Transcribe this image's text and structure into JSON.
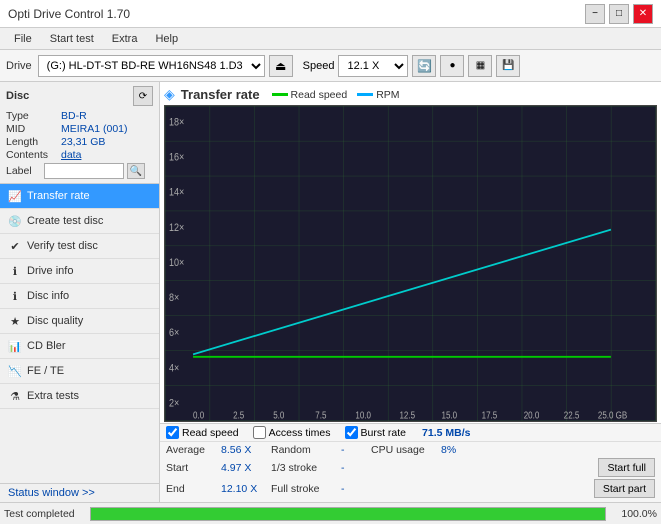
{
  "window": {
    "title": "Opti Drive Control 1.70",
    "min_label": "−",
    "max_label": "□",
    "close_label": "✕"
  },
  "menu": {
    "items": [
      "File",
      "Start test",
      "Extra",
      "Help"
    ]
  },
  "toolbar": {
    "drive_label": "Drive",
    "drive_value": "(G:)  HL-DT-ST BD-RE  WH16NS48 1.D3",
    "eject_icon": "⏏",
    "speed_label": "Speed",
    "speed_value": "12.1 X ▾",
    "toolbar_icons": [
      "🔄",
      "◉",
      "🖼",
      "💾"
    ]
  },
  "disc": {
    "title": "Disc",
    "type_label": "Type",
    "type_value": "BD-R",
    "mid_label": "MID",
    "mid_value": "MEIRA1 (001)",
    "length_label": "Length",
    "length_value": "23,31 GB",
    "contents_label": "Contents",
    "contents_value": "data",
    "label_label": "Label",
    "label_placeholder": ""
  },
  "nav": {
    "items": [
      {
        "id": "transfer-rate",
        "label": "Transfer rate",
        "active": true
      },
      {
        "id": "create-test-disc",
        "label": "Create test disc",
        "active": false
      },
      {
        "id": "verify-test-disc",
        "label": "Verify test disc",
        "active": false
      },
      {
        "id": "drive-info",
        "label": "Drive info",
        "active": false
      },
      {
        "id": "disc-info",
        "label": "Disc info",
        "active": false
      },
      {
        "id": "disc-quality",
        "label": "Disc quality",
        "active": false
      },
      {
        "id": "cd-bler",
        "label": "CD Bler",
        "active": false
      },
      {
        "id": "fe-te",
        "label": "FE / TE",
        "active": false
      },
      {
        "id": "extra-tests",
        "label": "Extra tests",
        "active": false
      }
    ]
  },
  "chart": {
    "title": "Transfer rate",
    "icon": "◈",
    "legend": {
      "read_speed_label": "Read speed",
      "read_speed_color": "#00cc00",
      "rpm_label": "RPM",
      "rpm_color": "#00aaff"
    },
    "x_labels": [
      "0.0",
      "2.5",
      "5.0",
      "7.5",
      "10.0",
      "12.5",
      "15.0",
      "17.5",
      "20.0",
      "22.5",
      "25.0 GB"
    ],
    "y_labels": [
      "18×",
      "16×",
      "14×",
      "12×",
      "10×",
      "8×",
      "6×",
      "4×",
      "2×"
    ],
    "burst_rate": "71.5 MB/s"
  },
  "checkboxes": {
    "read_speed": {
      "label": "Read speed",
      "checked": true
    },
    "access_times": {
      "label": "Access times",
      "checked": false
    },
    "burst_rate": {
      "label": "Burst rate",
      "checked": true
    },
    "burst_value": "71.5 MB/s"
  },
  "stats": {
    "average_label": "Average",
    "average_value": "8.56 X",
    "random_label": "Random",
    "random_value": "-",
    "cpu_label": "CPU usage",
    "cpu_value": "8%",
    "start_label": "Start",
    "start_value": "4.97 X",
    "stroke1_3_label": "1/3 stroke",
    "stroke1_3_value": "-",
    "start_full_label": "Start full",
    "end_label": "End",
    "end_value": "12.10 X",
    "full_stroke_label": "Full stroke",
    "full_stroke_value": "-",
    "start_part_label": "Start part"
  },
  "status": {
    "window_label": "Status window >>",
    "completed_text": "Test completed",
    "progress_pct": "100.0%"
  }
}
